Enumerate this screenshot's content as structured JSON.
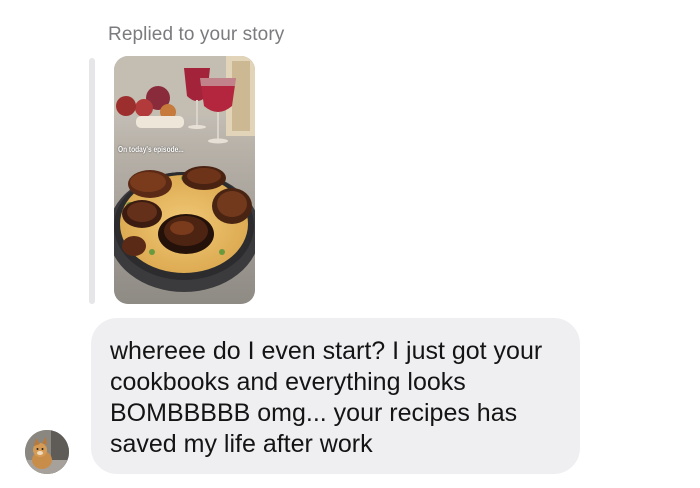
{
  "conversation": {
    "reply_label": "Replied to your story",
    "story": {
      "caption": "On today's episode..."
    },
    "message": {
      "text": "whereee do I even start? I just got your\ncookbooks and everything looks\nBOMBBBBB omg... your recipes has\nsaved my life after work"
    },
    "colors": {
      "bubble_background": "#efeff2",
      "quote_bar": "#e6e6e9",
      "label_text": "#7b7b7f",
      "message_text": "#141414"
    },
    "icons": {
      "avatar": "dog-avatar",
      "story_thumbnail": "food-photo"
    }
  }
}
